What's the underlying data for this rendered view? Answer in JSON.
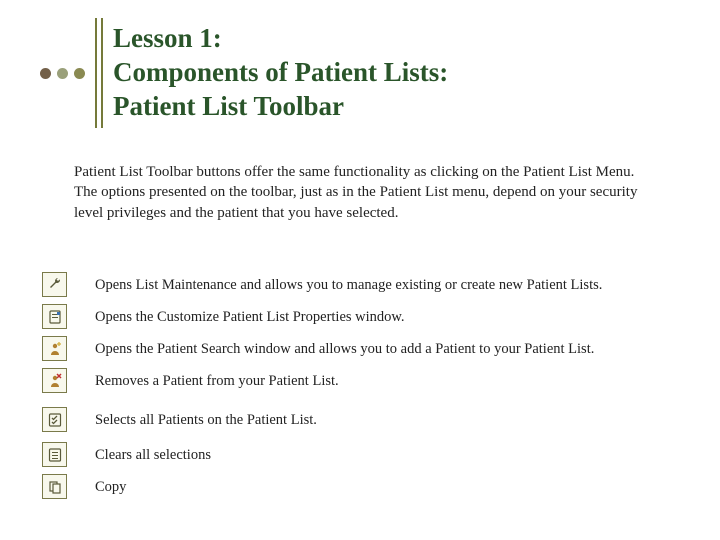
{
  "title": {
    "line1": "Lesson 1:",
    "line2": "Components of Patient Lists:",
    "line3": "Patient List Toolbar"
  },
  "intro": "Patient List Toolbar buttons offer the same functionality as clicking on the Patient List Menu. The options presented on the toolbar, just as in the Patient List menu, depend on your security level privileges and the patient that you have selected.",
  "items": [
    {
      "icon": "wrench-icon",
      "desc": "Opens List Maintenance and allows you to manage existing or create new Patient Lists."
    },
    {
      "icon": "properties-icon",
      "desc": "Opens the Customize Patient List Properties window."
    },
    {
      "icon": "add-patient-icon",
      "desc": "Opens the Patient Search window and allows you to add a Patient to your Patient List."
    },
    {
      "icon": "remove-patient-icon",
      "desc": "Removes a Patient from your Patient List."
    },
    {
      "icon": "select-all-icon",
      "desc": "Selects all Patients on the Patient List."
    },
    {
      "icon": "clear-all-icon",
      "desc": "Clears all selections"
    },
    {
      "icon": "copy-icon",
      "desc": "Copy"
    }
  ]
}
